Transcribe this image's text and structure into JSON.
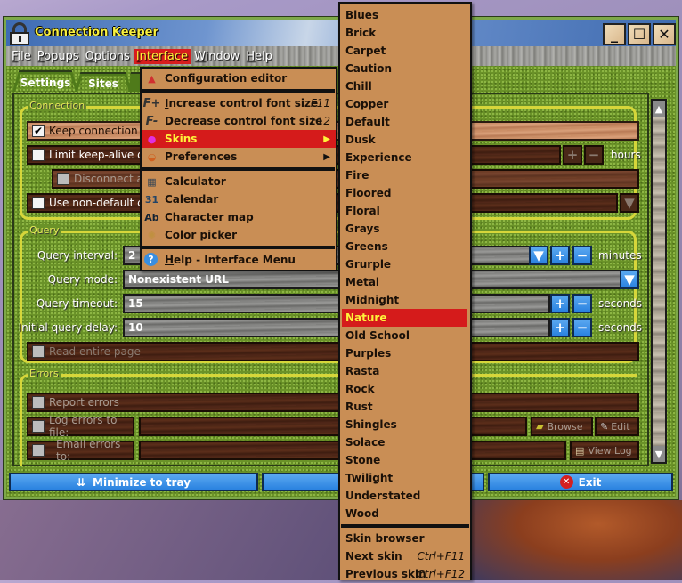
{
  "window": {
    "title": "Connection Keeper",
    "controls": {
      "minimize": "_",
      "maximize": "☐",
      "close": "✕"
    }
  },
  "menubar": [
    {
      "label": "File",
      "accel": "F"
    },
    {
      "label": "Popups",
      "accel": "P"
    },
    {
      "label": "Options",
      "accel": "O"
    },
    {
      "label": "Interface",
      "accel": "I",
      "active": true
    },
    {
      "label": "Window",
      "accel": "W"
    },
    {
      "label": "Help",
      "accel": "H"
    }
  ],
  "tabs": [
    {
      "label": "Settings",
      "active": true
    },
    {
      "label": "Sites"
    }
  ],
  "connection": {
    "group_label": "Connection",
    "keep_alive": {
      "label": "Keep connection alive",
      "checked": true
    },
    "limit_duration": {
      "label": "Limit keep-alive duration",
      "checked": false,
      "unit": "hours"
    },
    "disconnect_after": {
      "label": "Disconnect after",
      "checked": false,
      "disabled": true
    },
    "non_default": {
      "label": "Use non-default connection",
      "checked": false
    }
  },
  "query": {
    "group_label": "Query",
    "interval": {
      "label": "Query interval:",
      "value": "2",
      "unit": "minutes"
    },
    "mode": {
      "label": "Query mode:",
      "value": "Nonexistent URL"
    },
    "timeout": {
      "label": "Query timeout:",
      "value": "15",
      "unit": "seconds"
    },
    "initial_delay": {
      "label": "Initial query delay:",
      "value": "10",
      "unit": "seconds"
    },
    "read_entire_page": {
      "label": "Read entire page",
      "checked": false,
      "disabled": true
    }
  },
  "errors": {
    "group_label": "Errors",
    "report": {
      "label": "Report errors",
      "checked": false
    },
    "log_to_file": {
      "label": "Log errors to file:",
      "checked": false,
      "value": "",
      "browse_label": "Browse",
      "edit_label": "Edit"
    },
    "email_to": {
      "label": "Email errors to:",
      "checked": false,
      "value": "",
      "view_log_label": "View Log"
    }
  },
  "bottom_buttons": {
    "minimize": "Minimize to tray",
    "exit": "Exit"
  },
  "interface_menu": {
    "items": [
      {
        "label": "Configuration editor",
        "icon": "config-editor-icon"
      },
      {
        "sep": true
      },
      {
        "label": "Increase control font size",
        "accel": "I",
        "shortcut": "F11",
        "icon": "font-increase-icon"
      },
      {
        "label": "Decrease control font size",
        "accel": "D",
        "shortcut": "F12",
        "icon": "font-decrease-icon"
      },
      {
        "label": "Skins",
        "submenu": true,
        "highlighted": true,
        "icon": "skins-icon"
      },
      {
        "label": "Preferences",
        "submenu": true,
        "icon": "preferences-icon"
      },
      {
        "sep": true
      },
      {
        "label": "Calculator",
        "icon": "calculator-icon"
      },
      {
        "label": "Calendar",
        "icon": "calendar-icon"
      },
      {
        "label": "Character map",
        "icon": "character-map-icon"
      },
      {
        "label": "Color picker",
        "icon": "color-picker-icon"
      },
      {
        "sep": true
      },
      {
        "label": "Help - Interface Menu",
        "accel": "H",
        "icon": "help-icon"
      }
    ]
  },
  "skins_menu": {
    "skins": [
      "Blues",
      "Brick",
      "Carpet",
      "Caution",
      "Chill",
      "Copper",
      "Default",
      "Dusk",
      "Experience",
      "Fire",
      "Floored",
      "Floral",
      "Grays",
      "Greens",
      "Grurple",
      "Metal",
      "Midnight",
      "Nature",
      "Old School",
      "Purples",
      "Rasta",
      "Rock",
      "Rust",
      "Shingles",
      "Solace",
      "Stone",
      "Twilight",
      "Understated",
      "Wood"
    ],
    "selected": "Nature",
    "actions": [
      {
        "label": "Skin browser",
        "shortcut": ""
      },
      {
        "label": "Next skin",
        "shortcut": "Ctrl+F11"
      },
      {
        "label": "Previous skin",
        "shortcut": "Ctrl+F12"
      }
    ]
  },
  "colors": {
    "highlight": "#d51b1b",
    "highlight_text": "#fff33a",
    "menu_bg": "#c98e55",
    "title_text": "#f8f040",
    "group_border": "#d6d63a",
    "button_blue": "#3a90e8"
  }
}
